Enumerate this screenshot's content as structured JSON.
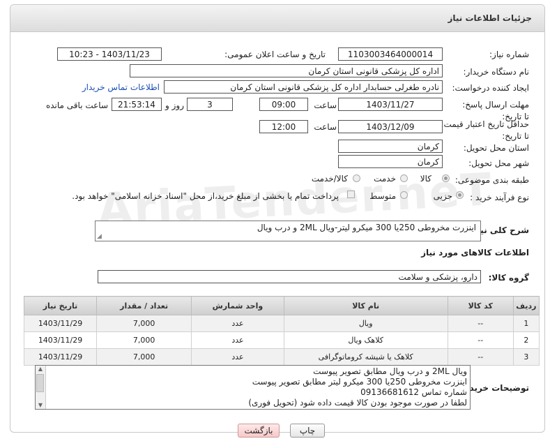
{
  "header": {
    "title": "جزئیات اطلاعات نیاز"
  },
  "watermark": "AriaTender.neT",
  "form": {
    "need_number_label": "شماره نیاز:",
    "need_number": "1103003464000014",
    "announce_label": "تاریخ و ساعت اعلان عمومی:",
    "announce_value": "1403/11/23 - 10:23",
    "buyer_org_label": "نام دستگاه خریدار:",
    "buyer_org": "اداره کل پزشکی قانونی استان کرمان",
    "creator_label": "ایجاد کننده درخواست:",
    "creator": "نادره طغرلی حسابدار اداره کل پزشکی قانونی استان کرمان",
    "contact_link": "اطلاعات تماس خریدار",
    "reply_deadline_label": "مهلت ارسال پاسخ: تا تاریخ:",
    "reply_date": "1403/11/27",
    "time_label": "ساعت",
    "reply_time": "09:00",
    "days": "3",
    "days_label": "روز و",
    "remaining_time": "21:53:14",
    "remaining_label": "ساعت باقی مانده",
    "price_validity_label": "حداقل تاریخ اعتبار قیمت: تا تاریخ:",
    "validity_date": "1403/12/09",
    "validity_time": "12:00",
    "province_label": "استان محل تحویل:",
    "province": "کرمان",
    "city_label": "شهر محل تحویل:",
    "city": "کرمان",
    "category_label": "طبقه بندی موضوعی:",
    "category_options": [
      "کالا",
      "خدمت",
      "کالا/خدمت"
    ],
    "category_selected": "کالا",
    "process_label": "نوع فرآیند خرید :",
    "process_options": [
      "جزیی",
      "متوسط"
    ],
    "process_selected": "جزیی",
    "payment_note": "پرداخت تمام یا بخشی از مبلغ خرید،از محل \"اسناد خزانه اسلامی\" خواهد بود."
  },
  "summary": {
    "label": "شرح کلی نیاز:",
    "text": "اینزرت  مخروطی 250یا 300 میکرو لیتر-ویال 2ML و درب ویال"
  },
  "goods": {
    "section_title": "اطلاعات کالاهای مورد نیاز",
    "group_label": "گروه کالا:",
    "group_value": "دارو، پزشکی و سلامت"
  },
  "table": {
    "headers": [
      "ردیف",
      "کد کالا",
      "نام کالا",
      "واحد شمارش",
      "تعداد / مقدار",
      "تاریخ نیاز"
    ],
    "rows": [
      [
        "1",
        "--",
        "ویال",
        "عدد",
        "7,000",
        "1403/11/29"
      ],
      [
        "2",
        "--",
        "کلاهک ویال",
        "عدد",
        "7,000",
        "1403/11/29"
      ],
      [
        "3",
        "--",
        "کلاهک یا شیشه کروماتوگرافی",
        "عدد",
        "7,000",
        "1403/11/29"
      ]
    ]
  },
  "buyer_notes": {
    "label": "توضیحات خریدار:",
    "lines": [
      "ویال 2ML و درب ویال مطابق تصویر پیوست",
      "اینزرت  مخروطی 250یا 300 میکرو لیتر مطابق تصویر پیوست",
      "شماره تماس    09136681612",
      "لطفا در صورت موجود بودن کالا قیمت داده شود (تحویل فوری)"
    ]
  },
  "buttons": {
    "print": "چاپ",
    "back": "بازگشت"
  }
}
